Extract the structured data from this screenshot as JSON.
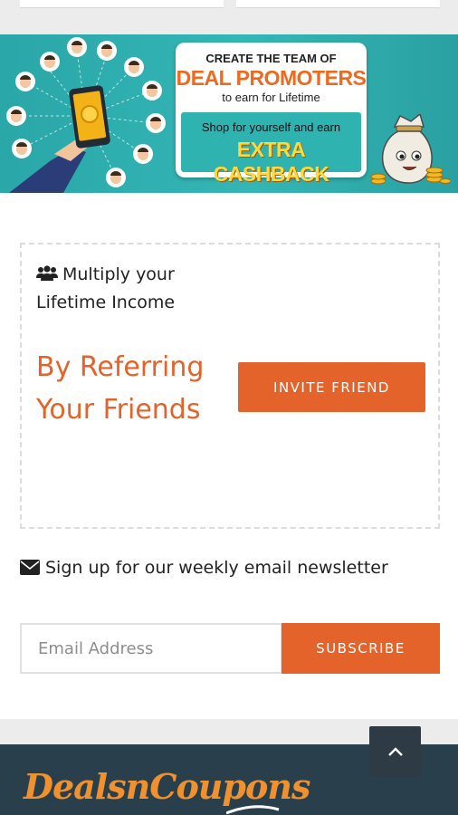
{
  "banner": {
    "line1": "CREATE THE TEAM OF",
    "line2": "DEAL PROMOTERS",
    "line3": "to earn for Lifetime",
    "line4": "Shop for yourself and earn",
    "line5": "EXTRA CASHBACK"
  },
  "referral": {
    "multiply_text": "Multiply your Lifetime Income",
    "refer_text": "By Referring Your Friends",
    "invite_button": "INVITE FRIEND"
  },
  "newsletter": {
    "text": "Sign up for our weekly email newsletter",
    "email_placeholder": "Email Address",
    "subscribe_button": "SUBSCRIBE"
  },
  "footer": {
    "logo_text": "DealsnCoupons"
  },
  "icons": {
    "users": "users-icon",
    "envelope": "envelope-icon",
    "scroll_top": "chevron-up-icon"
  },
  "colors": {
    "accent": "#e3632a",
    "banner_teal": "#2fb3b1",
    "footer_bg": "#2a3f4c",
    "logo_orange": "#f0912f"
  }
}
